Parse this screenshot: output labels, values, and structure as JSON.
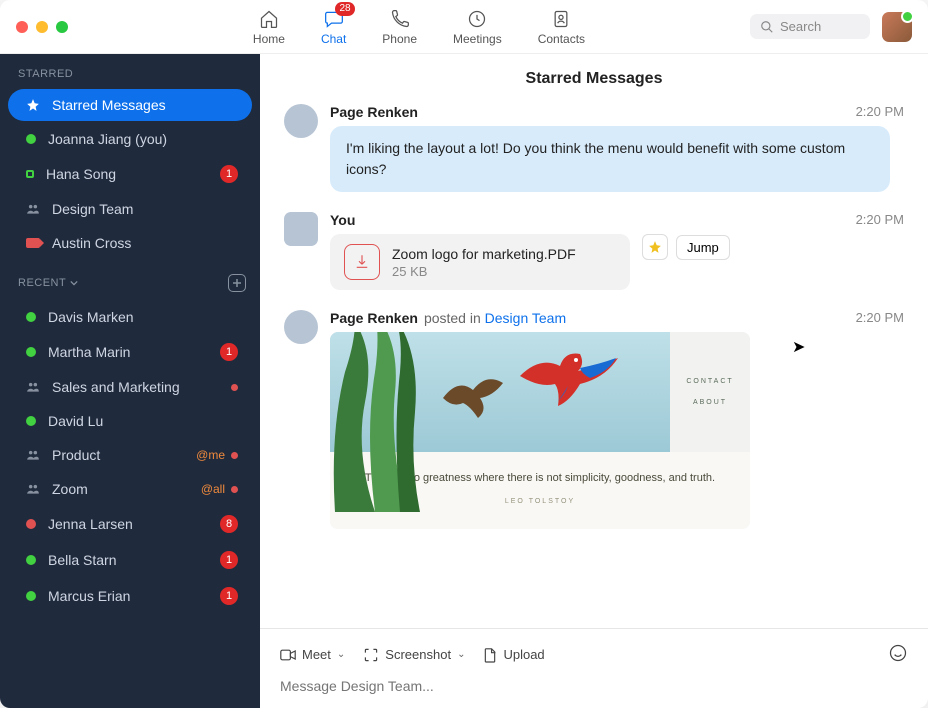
{
  "nav": {
    "home": "Home",
    "chat": "Chat",
    "phone": "Phone",
    "meetings": "Meetings",
    "contacts": "Contacts",
    "chat_badge": "28"
  },
  "search": {
    "placeholder": "Search"
  },
  "sidebar": {
    "starred_label": "STARRED",
    "recent_label": "RECENT",
    "starred_items": [
      {
        "label": "Starred Messages"
      },
      {
        "label": "Joanna Jiang (you)"
      },
      {
        "label": "Hana Song",
        "count": "1"
      },
      {
        "label": "Design Team"
      },
      {
        "label": "Austin Cross"
      }
    ],
    "recent_items": [
      {
        "label": "Davis Marken"
      },
      {
        "label": "Martha Marin",
        "count": "1"
      },
      {
        "label": "Sales and Marketing"
      },
      {
        "label": "David Lu"
      },
      {
        "label": "Product",
        "mention": "@me"
      },
      {
        "label": "Zoom",
        "mention": "@all"
      },
      {
        "label": "Jenna Larsen",
        "count": "8"
      },
      {
        "label": "Bella Starn",
        "count": "1"
      },
      {
        "label": "Marcus Erian",
        "count": "1"
      }
    ]
  },
  "main": {
    "title": "Starred Messages",
    "messages": [
      {
        "author": "Page Renken",
        "time": "2:20 PM",
        "text": "I'm liking the layout a lot! Do you think the menu would benefit with some custom icons?"
      },
      {
        "author": "You",
        "time": "2:20 PM",
        "file": {
          "name": "Zoom logo for marketing.PDF",
          "size": "25 KB"
        },
        "jump": "Jump"
      },
      {
        "author": "Page Renken",
        "context_verb": " posted in ",
        "context_link": "Design Team",
        "time": "2:20 PM",
        "preview": {
          "menu1": "CONTACT",
          "menu2": "ABOUT",
          "quote": "There is no greatness where there is not simplicity, goodness, and truth.",
          "attr": "LEO TOLSTOY"
        }
      }
    ],
    "composer": {
      "meet": "Meet",
      "screenshot": "Screenshot",
      "upload": "Upload",
      "placeholder": "Message Design Team..."
    }
  }
}
